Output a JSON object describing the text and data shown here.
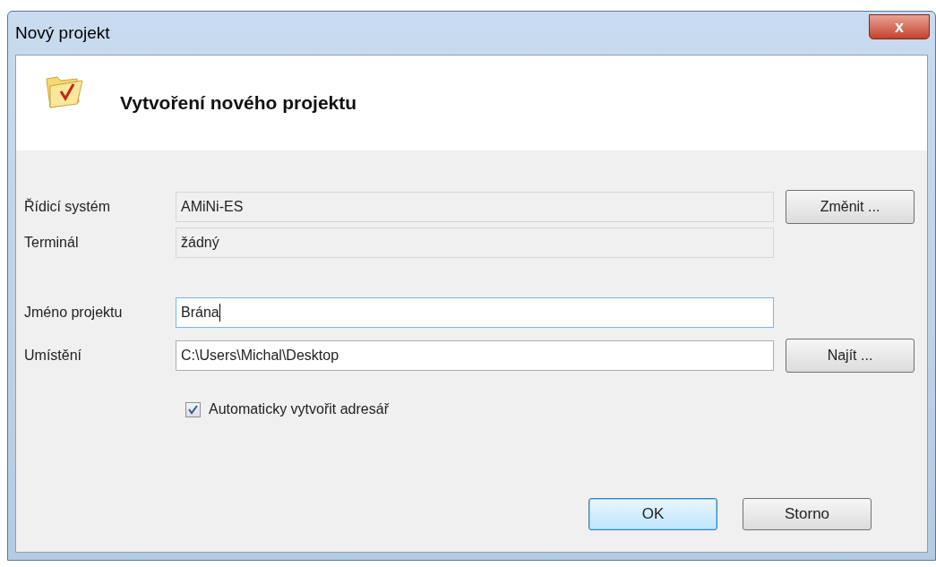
{
  "window": {
    "title": "Nový projekt",
    "close": "x"
  },
  "header": {
    "title": "Vytvoření nového projektu"
  },
  "rows": [
    {
      "label": "Řídicí systém",
      "value": "AMiNi-ES",
      "readonly": true,
      "focused": false,
      "button": "Změnit ..."
    },
    {
      "label": "Terminál",
      "value": "žádný",
      "readonly": true,
      "focused": false
    },
    {
      "label": "Jméno projektu",
      "value": "Brána",
      "readonly": false,
      "focused": true
    },
    {
      "label": "Umístění",
      "value": "C:\\Users\\Michal\\Desktop",
      "readonly": false,
      "focused": false,
      "button": "Najít ..."
    }
  ],
  "checkbox": {
    "label": "Automaticky vytvořit adresář",
    "checked": true
  },
  "buttons": [
    {
      "label": "OK",
      "default": true
    },
    {
      "label": "Storno",
      "default": false
    }
  ]
}
